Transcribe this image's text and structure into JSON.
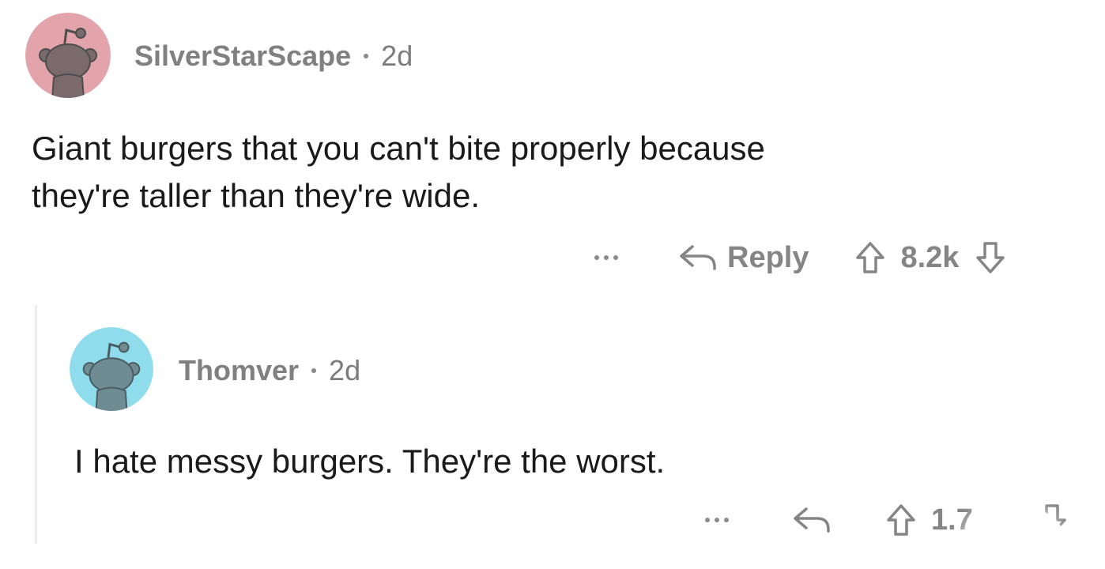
{
  "comments": [
    {
      "author": "SilverStarScape",
      "age": "2d",
      "body_line1": "Giant burgers that you can't bite properly because",
      "body_line2": "they're taller than they're wide.",
      "reply_label": "Reply",
      "score": "8.2k",
      "avatar_color": "#e2a3ab",
      "avatar_icon": "snoo-avatar-icon"
    },
    {
      "author": "Thomver",
      "age": "2d",
      "body": "I hate messy burgers. They're the worst.",
      "score": "1.7",
      "avatar_color": "#8fdcec",
      "avatar_icon": "snoo-avatar-icon"
    }
  ],
  "colors": {
    "meta_text": "#7c7c7c",
    "body_text": "#1a1a1b",
    "action_text": "#858585",
    "thread_line": "#ededed"
  }
}
